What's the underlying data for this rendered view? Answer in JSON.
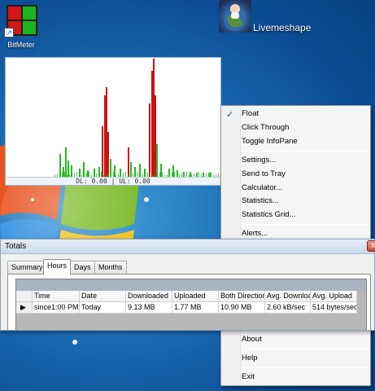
{
  "desktop": {
    "shortcuts": [
      {
        "label": "BitMeter",
        "icon": "bitmeter-icon"
      },
      {
        "label": "Livemeshape",
        "icon": "globe-baby-icon"
      }
    ]
  },
  "graph": {
    "status_text": "DL: 0.00 | UL: 0.00",
    "colors": {
      "download": "#cc1111",
      "upload": "#22bb22",
      "background": "#ffffff"
    }
  },
  "context_menu": {
    "items": [
      {
        "label": "Float",
        "checked": true
      },
      {
        "label": "Click Through"
      },
      {
        "label": "Toggle InfoPane"
      },
      {
        "label": "Settings..."
      },
      {
        "label": "Send to Tray"
      },
      {
        "label": "Calculator..."
      },
      {
        "label": "Statistics..."
      },
      {
        "label": "Statistics Grid..."
      },
      {
        "label": "Alerts..."
      },
      {
        "label": "About"
      },
      {
        "label": "Help"
      },
      {
        "label": "Exit"
      }
    ]
  },
  "totals": {
    "title": "Totals",
    "close_glyph": "x",
    "tabs": [
      "Summary",
      "Hours",
      "Days",
      "Months"
    ],
    "active_tab": "Hours",
    "columns": [
      "Time",
      "Date",
      "Downloaded",
      "Uploaded",
      "Both Direction",
      "Avg. Downloa",
      "Avg. Upload"
    ],
    "rows": [
      {
        "marker": "▶",
        "cells": [
          "since1:00 PM",
          "Today",
          "9.13 MB",
          "1.77 MB",
          "10.90 MB",
          "2.60 kB/sec",
          "514 bytes/sec"
        ]
      }
    ]
  }
}
